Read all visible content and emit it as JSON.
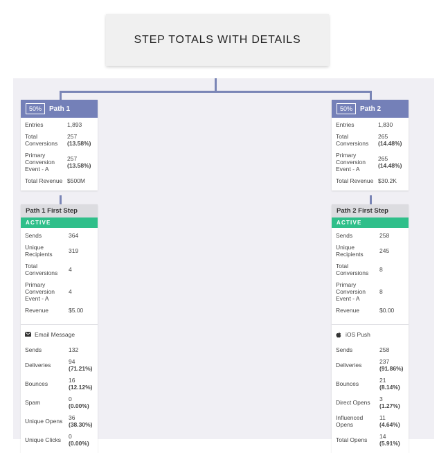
{
  "header": {
    "title": "STEP TOTALS WITH DETAILS"
  },
  "colors": {
    "path_header": "#7480b8",
    "connector": "#7a85b6",
    "active": "#2fbf8a",
    "canvas": "#f0eff4"
  },
  "paths": [
    {
      "percent": "50%",
      "name": "Path 1",
      "stats": [
        {
          "label": "Entries",
          "value": "1,893",
          "pct": ""
        },
        {
          "label": "Total Conversions",
          "value": "257",
          "pct": "(13.58%)"
        },
        {
          "label": "Primary Conversion Event - A",
          "value": "257",
          "pct": "(13.58%)"
        },
        {
          "label": "Total Revenue",
          "value": "$500M",
          "pct": ""
        }
      ],
      "step": {
        "title": "Path 1 First Step",
        "status": "ACTIVE",
        "stats": [
          {
            "label": "Sends",
            "value": "364",
            "pct": ""
          },
          {
            "label": "Unique Recipients",
            "value": "319",
            "pct": ""
          },
          {
            "label": "Total Conversions",
            "value": "4",
            "pct": ""
          },
          {
            "label": "Primary Conversion Event - A",
            "value": "4",
            "pct": ""
          },
          {
            "label": "Revenue",
            "value": "$5.00",
            "pct": ""
          }
        ],
        "message": {
          "icon": "envelope-icon",
          "title": "Email Message",
          "stats": [
            {
              "label": "Sends",
              "value": "132",
              "pct": ""
            },
            {
              "label": "Deliveries",
              "value": "94",
              "pct": "(71.21%)"
            },
            {
              "label": "Bounces",
              "value": "16",
              "pct": "(12.12%)"
            },
            {
              "label": "Spam",
              "value": "0",
              "pct": "(0.00%)"
            },
            {
              "label": "Unique Opens",
              "value": "36",
              "pct": "(38.30%)"
            },
            {
              "label": "Unique Clicks",
              "value": "0",
              "pct": "(0.00%)"
            }
          ]
        }
      }
    },
    {
      "percent": "50%",
      "name": "Path 2",
      "stats": [
        {
          "label": "Entries",
          "value": "1,830",
          "pct": ""
        },
        {
          "label": "Total Conversions",
          "value": "265",
          "pct": "(14.48%)"
        },
        {
          "label": "Primary Conversion Event - A",
          "value": "265",
          "pct": "(14.48%)"
        },
        {
          "label": "Total Revenue",
          "value": "$30.2K",
          "pct": ""
        }
      ],
      "step": {
        "title": "Path 2 First Step",
        "status": "ACTIVE",
        "stats": [
          {
            "label": "Sends",
            "value": "258",
            "pct": ""
          },
          {
            "label": "Unique Recipients",
            "value": "245",
            "pct": ""
          },
          {
            "label": "Total Conversions",
            "value": "8",
            "pct": ""
          },
          {
            "label": "Primary Conversion Event - A",
            "value": "8",
            "pct": ""
          },
          {
            "label": "Revenue",
            "value": "$0.00",
            "pct": ""
          }
        ],
        "message": {
          "icon": "apple-icon",
          "title": "iOS Push",
          "stats": [
            {
              "label": "Sends",
              "value": "258",
              "pct": ""
            },
            {
              "label": "Deliveries",
              "value": "237",
              "pct": "(91.86%)"
            },
            {
              "label": "Bounces",
              "value": "21",
              "pct": "(8.14%)"
            },
            {
              "label": "Direct Opens",
              "value": "3",
              "pct": "(1.27%)"
            },
            {
              "label": "Influenced Opens",
              "value": "11",
              "pct": "(4.64%)"
            },
            {
              "label": "Total Opens",
              "value": "14",
              "pct": "(5.91%)"
            }
          ]
        }
      }
    }
  ]
}
